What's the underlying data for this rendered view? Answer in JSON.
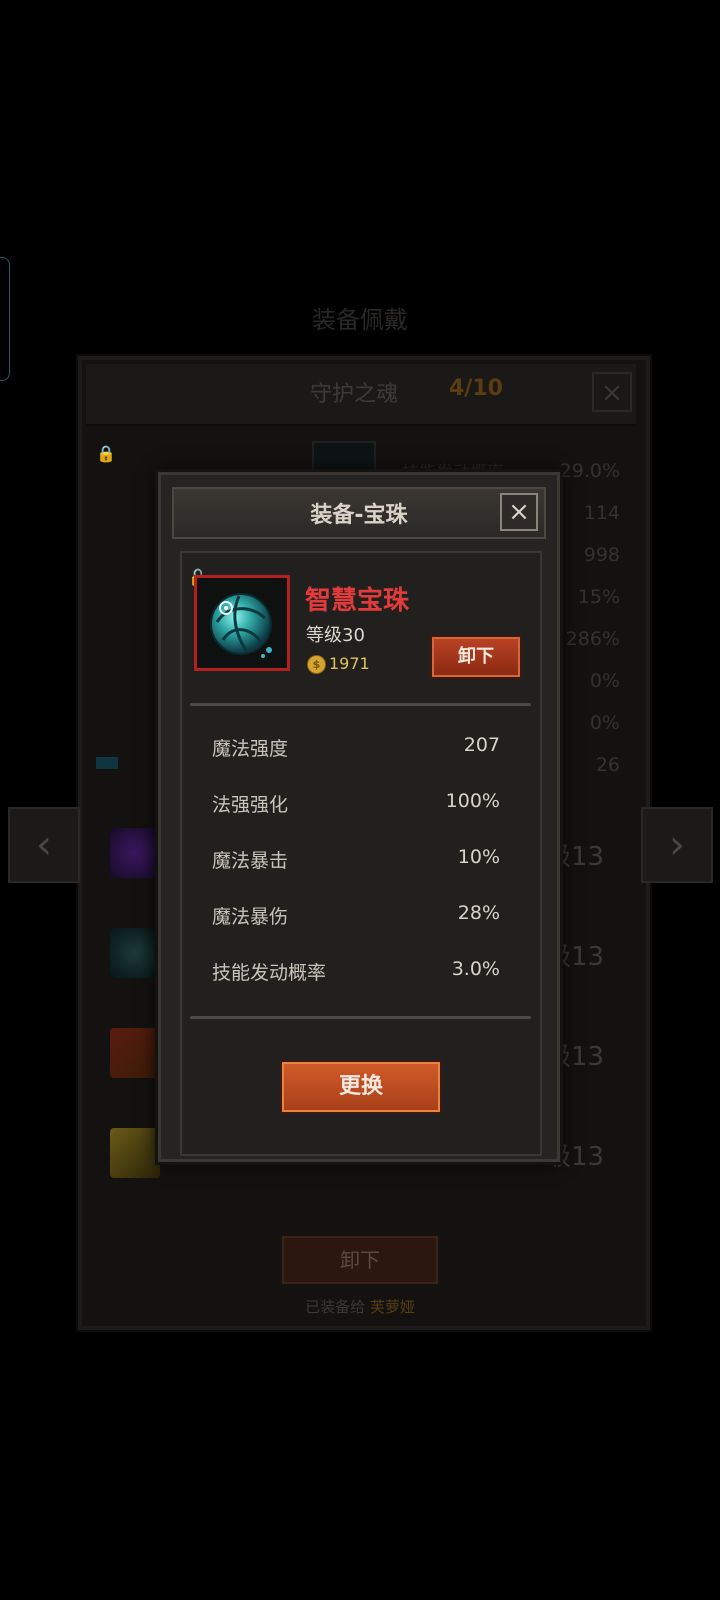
{
  "background": {
    "title": "装备佩戴",
    "panel": {
      "title": "守护之魂",
      "count": "4/10",
      "close_icon": "close-icon",
      "stats_label": "技能发动概率",
      "stats": [
        "29.0%",
        "114",
        "998",
        "15%",
        "286%",
        "0%",
        "0%",
        "26"
      ],
      "skill_levels": [
        "级13",
        "级13",
        "级13",
        "级13"
      ],
      "unequip_label": "卸下",
      "equipped_prefix": "已装备给",
      "equipped_name": "芙萝娅"
    }
  },
  "modal": {
    "title": "装备-宝珠",
    "close_icon": "close-icon",
    "item": {
      "name": "智慧宝珠",
      "level": "等级30",
      "price": "1971",
      "icon": "orb-icon",
      "name_color": "#e23b3b",
      "frame_color": "#b32020"
    },
    "unequip_label": "卸下",
    "stats": [
      {
        "label": "魔法强度",
        "value": "207"
      },
      {
        "label": "法强强化",
        "value": "100%"
      },
      {
        "label": "魔法暴击",
        "value": "10%"
      },
      {
        "label": "魔法暴伤",
        "value": "28%"
      },
      {
        "label": "技能发动概率",
        "value": "3.0%"
      }
    ],
    "swap_label": "更换"
  }
}
